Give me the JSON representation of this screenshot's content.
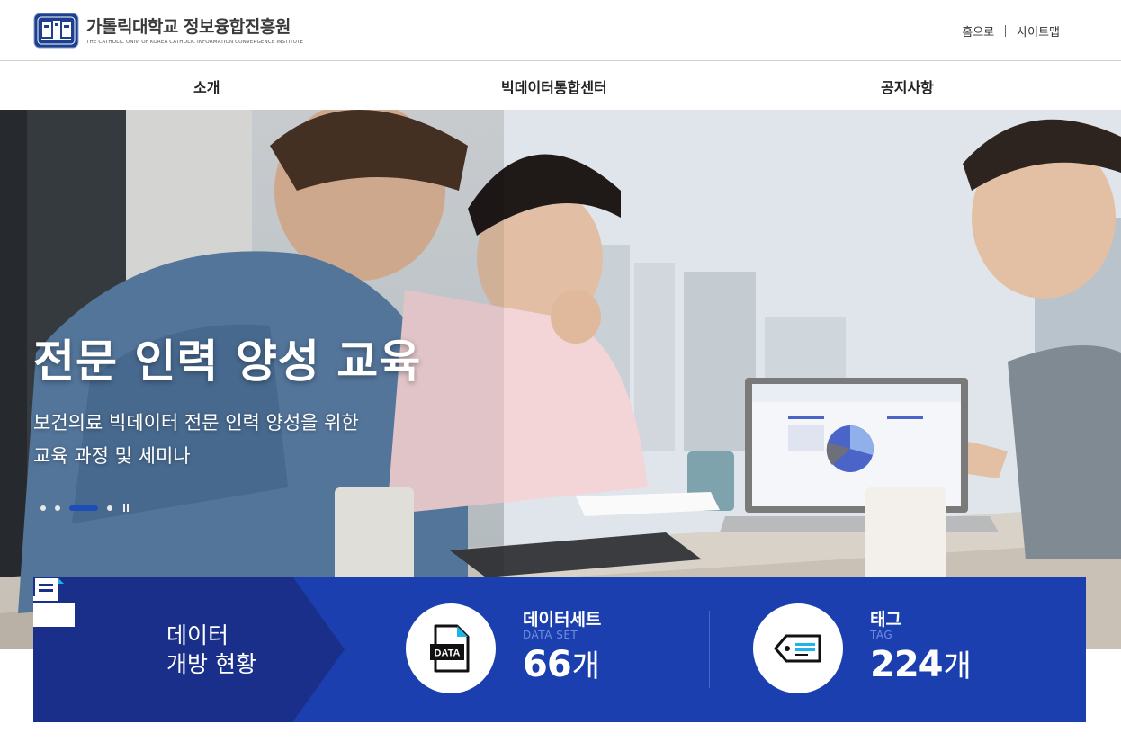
{
  "header": {
    "logo_title": "가톨릭대학교 정보융합진흥원",
    "logo_subtitle": "THE CATHOLIC UNIV. OF KOREA CATHOLIC INFORMATION CONVERGENCE INSTITUTE",
    "util_links": [
      {
        "label": "홈으로"
      },
      {
        "label": "사이트맵"
      }
    ]
  },
  "nav": {
    "items": [
      {
        "label": "소개"
      },
      {
        "label": "빅데이터통합센터"
      },
      {
        "label": "공지사항"
      }
    ]
  },
  "hero": {
    "title": "전문 인력 양성 교육",
    "description_line1": "보건의료 빅데이터 전문 인력 양성을 위한",
    "description_line2": "교육 과정 및 세미나",
    "slide_count": 4,
    "active_slide": 3
  },
  "stats": {
    "heading_line1": "데이터",
    "heading_line2": "개방 현황",
    "items": [
      {
        "name": "데이터세트",
        "name_en": "DATA SET",
        "value": "66",
        "unit": "개",
        "icon": "data-file-icon",
        "icon_text": "DATA"
      },
      {
        "name": "태그",
        "name_en": "TAG",
        "value": "224",
        "unit": "개",
        "icon": "tag-icon"
      }
    ]
  },
  "colors": {
    "primary_blue": "#1b3faf",
    "dark_blue": "#1a2f8a",
    "accent_cyan": "#1eb4e6",
    "active_dot": "#1f4db8"
  }
}
